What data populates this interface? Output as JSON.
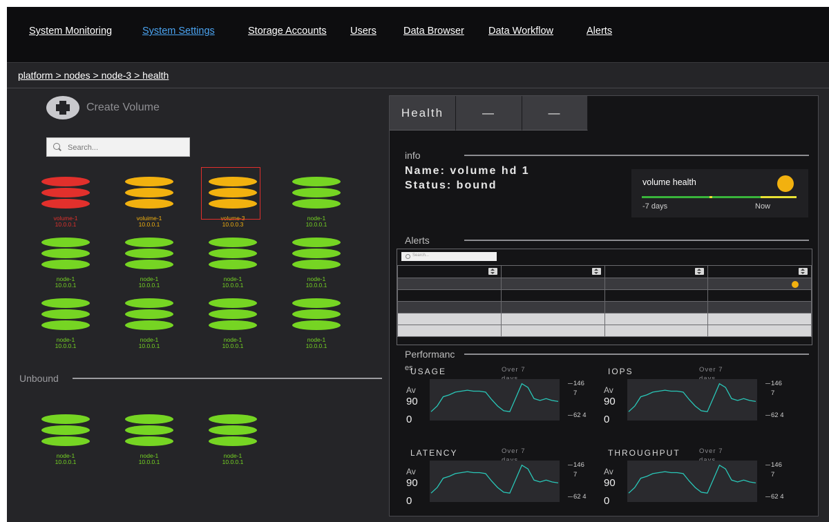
{
  "nav": {
    "items": [
      "System Monitoring",
      "System Settings",
      "Storage Accounts",
      "Users",
      "Data Browser",
      "Data Workflow",
      "Alerts"
    ],
    "active": "System Settings"
  },
  "breadcrumb": "platform > nodes > node-3 > health",
  "sidebar": {
    "create_label": "Create Volume",
    "search_placeholder": "Search...",
    "nodes": [
      {
        "name": "volume-1",
        "ip": "10.0.0.1",
        "status": "error",
        "color": "#e2302c"
      },
      {
        "name": "voluime-1",
        "ip": "10.0.0.1",
        "status": "warning",
        "color": "#f2b10f"
      },
      {
        "name": "volume-3",
        "ip": "10.0.0.3",
        "status": "warning",
        "color": "#f2b10f",
        "selected": true
      },
      {
        "name": "node-1",
        "ip": "10.0.0.1",
        "status": "ok",
        "color": "#76d523"
      },
      {
        "name": "node-1",
        "ip": "10.0.0.1",
        "status": "ok",
        "color": "#76d523"
      },
      {
        "name": "node-1",
        "ip": "10.0.0.1",
        "status": "ok",
        "color": "#76d523"
      },
      {
        "name": "node-1",
        "ip": "10.0.0.1",
        "status": "ok",
        "color": "#76d523"
      },
      {
        "name": "node-1",
        "ip": "10.0.0.1",
        "status": "ok",
        "color": "#76d523"
      },
      {
        "name": "node-1",
        "ip": "10.0.0.1",
        "status": "ok",
        "color": "#76d523"
      },
      {
        "name": "node-1",
        "ip": "10.0.0.1",
        "status": "ok",
        "color": "#76d523"
      },
      {
        "name": "node-1",
        "ip": "10.0.0.1",
        "status": "ok",
        "color": "#76d523"
      },
      {
        "name": "node-1",
        "ip": "10.0.0.1",
        "status": "ok",
        "color": "#76d523"
      }
    ],
    "unbound_label": "Unbound",
    "unbound_nodes": [
      {
        "name": "node-1",
        "ip": "10.0.0.1",
        "color": "#76d523"
      },
      {
        "name": "node-1",
        "ip": "10.0.0.1",
        "color": "#76d523"
      },
      {
        "name": "node-1",
        "ip": "10.0.0.1",
        "color": "#76d523"
      }
    ]
  },
  "panel": {
    "tabs": [
      "Health",
      "—",
      "—"
    ],
    "info_label": "info",
    "name_line": "Name: volume hd 1",
    "status_line": "Status: bound",
    "volume_health": {
      "title": "volume health",
      "start": "-7 days",
      "end": "Now",
      "status_color": "#f2b10f"
    },
    "alerts_label": "Alerts",
    "alerts_search_placeholder": "Search...",
    "alerts_rows": 5,
    "performance_label": "Performanc",
    "performance_label_suffix": "es",
    "metrics": [
      {
        "title": "USAGE",
        "period": "Over 7 days",
        "avg_label": "Av",
        "avg_value": "90",
        "avg_unit": "0",
        "ymax": "146 7",
        "ymin": "62 4",
        "values": [
          8,
          14,
          24,
          26,
          29,
          30,
          31,
          30,
          30,
          29,
          21,
          14,
          9,
          8,
          23,
          38,
          34,
          22,
          20,
          22,
          20,
          19
        ]
      },
      {
        "title": "IOPS",
        "period": "Over 7 days",
        "avg_label": "Av",
        "avg_value": "90",
        "avg_unit": "0",
        "ymax": "146 7",
        "ymin": "62 4",
        "values": [
          8,
          14,
          24,
          26,
          29,
          30,
          31,
          30,
          30,
          29,
          21,
          14,
          9,
          8,
          23,
          38,
          34,
          22,
          20,
          22,
          20,
          19
        ]
      },
      {
        "title": "LATENCY",
        "period": "Over 7 days",
        "avg_label": "Av",
        "avg_value": "90",
        "avg_unit": "0",
        "ymax": "146 7",
        "ymin": "62 4",
        "values": [
          8,
          14,
          24,
          26,
          29,
          30,
          31,
          30,
          30,
          29,
          21,
          14,
          9,
          8,
          23,
          38,
          34,
          22,
          20,
          22,
          20,
          19
        ]
      },
      {
        "title": "THROUGHPUT",
        "period": "Over 7 days",
        "avg_label": "Av",
        "avg_value": "90",
        "avg_unit": "0",
        "ymax": "146 7",
        "ymin": "62 4",
        "values": [
          8,
          14,
          24,
          26,
          29,
          30,
          31,
          30,
          30,
          29,
          21,
          14,
          9,
          8,
          23,
          38,
          34,
          22,
          20,
          22,
          20,
          19
        ]
      }
    ]
  },
  "colors": {
    "accent": "#4aa3f0",
    "ok": "#76d523",
    "warning": "#f2b10f",
    "error": "#e2302c",
    "line": "#29c7b8"
  }
}
